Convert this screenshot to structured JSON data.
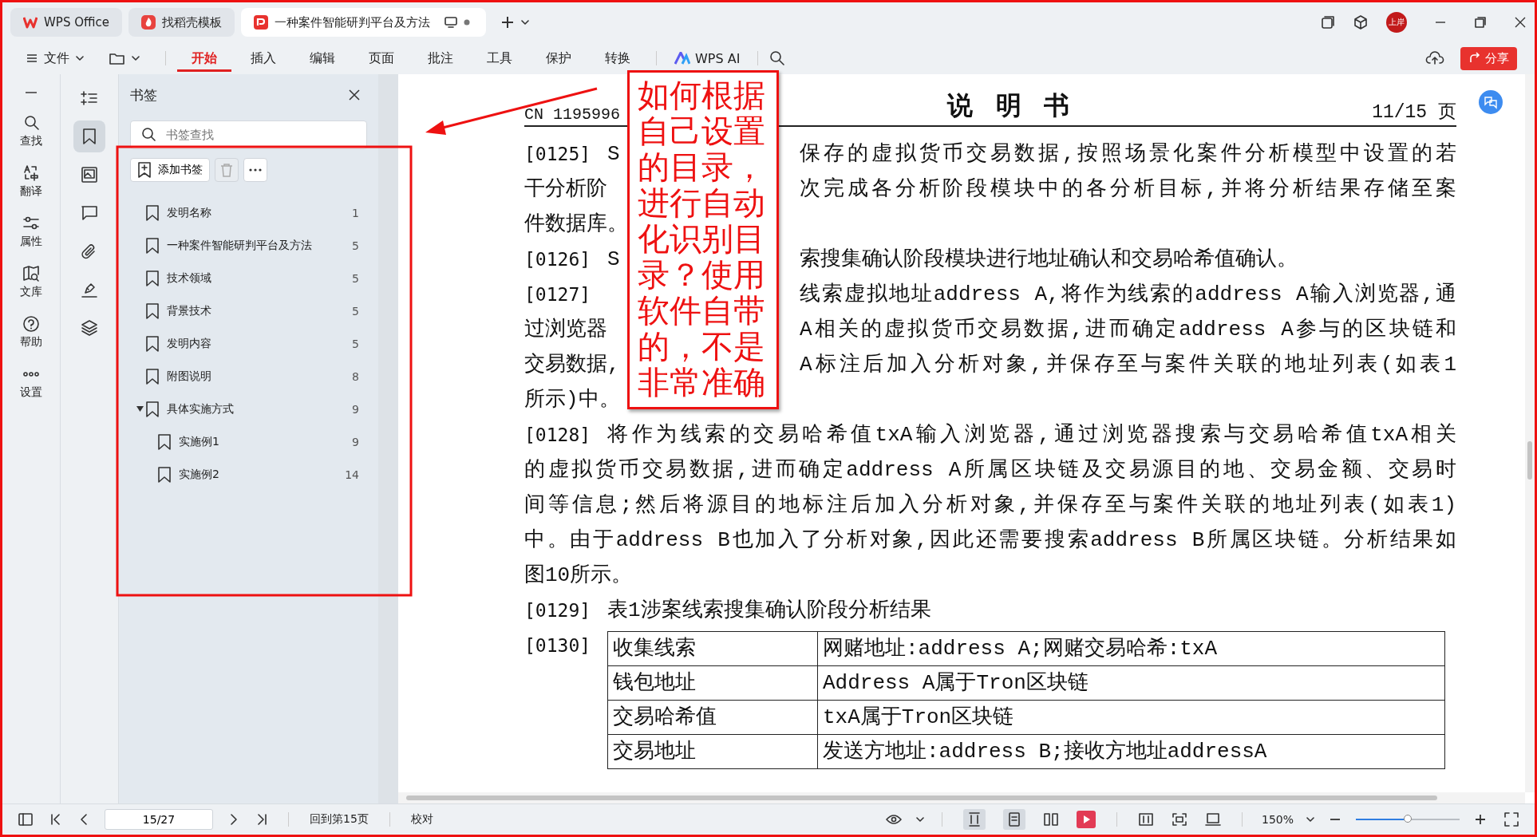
{
  "window": {
    "tabs": [
      {
        "kind": "home",
        "label": "WPS Office",
        "selected": false
      },
      {
        "kind": "template",
        "label": "找稻壳模板",
        "selected": false
      },
      {
        "kind": "document",
        "label": "一种案件智能研判平台及方法",
        "selected": true
      }
    ],
    "avatar": "上岸"
  },
  "menu": {
    "file": "文件",
    "tabs": [
      {
        "label": "开始",
        "selected": true
      },
      {
        "label": "插入",
        "selected": false
      },
      {
        "label": "编辑",
        "selected": false
      },
      {
        "label": "页面",
        "selected": false
      },
      {
        "label": "批注",
        "selected": false
      },
      {
        "label": "工具",
        "selected": false
      },
      {
        "label": "保护",
        "selected": false
      },
      {
        "label": "转换",
        "selected": false
      }
    ],
    "ai": "WPS AI",
    "share": "分享"
  },
  "left_rail": [
    {
      "kind": "search",
      "label": "查找"
    },
    {
      "kind": "translate",
      "label": "翻译"
    },
    {
      "kind": "properties",
      "label": "属性"
    },
    {
      "kind": "library",
      "label": "文库"
    },
    {
      "kind": "help",
      "label": "帮助"
    },
    {
      "kind": "more",
      "label": "设置"
    }
  ],
  "tool_rail": [
    {
      "kind": "outline",
      "selected": false
    },
    {
      "kind": "bookmark",
      "selected": true
    },
    {
      "kind": "image",
      "selected": false
    },
    {
      "kind": "comment",
      "selected": false
    },
    {
      "kind": "attachment",
      "selected": false
    },
    {
      "kind": "signature",
      "selected": false
    },
    {
      "kind": "layers",
      "selected": false
    }
  ],
  "bookmarks": {
    "title": "书签",
    "search": {
      "placeholder": "书签查找"
    },
    "add_button": "添加书签",
    "delete_button": {
      "disabled": true
    },
    "items": [
      {
        "label": "发明名称",
        "page": "1"
      },
      {
        "label": "一种案件智能研判平台及方法",
        "page": "5"
      },
      {
        "label": "技术领域",
        "page": "5"
      },
      {
        "label": "背景技术",
        "page": "5"
      },
      {
        "label": "发明内容",
        "page": "5"
      },
      {
        "label": "附图说明",
        "page": "8"
      },
      {
        "label": "具体实施方式",
        "page": "9",
        "expanded": true,
        "children": [
          {
            "label": "实施例1",
            "page": "9"
          },
          {
            "label": "实施例2",
            "page": "14"
          }
        ]
      }
    ]
  },
  "document": {
    "header": {
      "number": "CN 1195996",
      "title": "说明书",
      "page": "11/15 页"
    },
    "paragraphs": [
      {
        "number": "[0125]",
        "lines": [
          {
            "left": "S",
            "right": "保存的虚拟货币交易数据,按照场景化案件分析模型中设置的若"
          },
          {
            "left": "干分析阶",
            "right": "次完成各分析阶段模块中的各分析目标,并将分析结果存储至案"
          },
          {
            "left": "件数据库。"
          }
        ]
      },
      {
        "number": "[0126]",
        "lines": [
          {
            "left": "S",
            "right": "索搜集确认阶段模块进行地址确认和交易哈希值确认。"
          }
        ]
      },
      {
        "number": "[0127]",
        "lines": [
          {
            "right": "线索虚拟地址address A,将作为线索的address A输入浏览器,通"
          },
          {
            "left": "过浏览器",
            "right": "A相关的虚拟货币交易数据,进而确定address A参与的区块链和"
          },
          {
            "left": "交易数据,",
            "right": "A标注后加入分析对象,并保存至与案件关联的地址列表(如表1"
          },
          {
            "left": "所示)中。"
          }
        ]
      },
      {
        "number": "[0128]",
        "lines": [
          {
            "left": "将作为线索的交易哈希值txA输入浏览器,通过浏览器搜索与交易哈希值txA相关"
          },
          {
            "left": "的虚拟货币交易数据,进而确定address A所属区块链及交易源目的地、交易金额、交易时"
          },
          {
            "left": "间等信息;然后将源目的地标注后加入分析对象,并保存至与案件关联的地址列表(如表1)"
          },
          {
            "left": "中。由于address B也加入了分析对象,因此还需要搜索address B所属区块链。分析结果如"
          },
          {
            "left": "图10所示。"
          }
        ]
      },
      {
        "number": "[0129]",
        "lines": [
          {
            "left": "表1涉案线索搜集确认阶段分析结果"
          }
        ]
      }
    ],
    "table": {
      "number": "[0130]",
      "rows": [
        [
          "收集线索",
          "网赌地址:address A;网赌交易哈希:txA"
        ],
        [
          "钱包地址",
          "Address A属于Tron区块链"
        ],
        [
          "交易哈希值",
          "txA属于Tron区块链"
        ],
        [
          "交易地址",
          "发送方地址:address B;接收方地址addressA"
        ]
      ]
    }
  },
  "annotation": {
    "text": "如何根据自己设置的目录，进行自动化识别目录？使用软件自带的，不是非常准确"
  },
  "status_bar": {
    "page": "15/27",
    "back": "回到第15页",
    "proofread": "校对",
    "zoom": "150%",
    "zoom_slider": {
      "level": 0.5
    }
  }
}
